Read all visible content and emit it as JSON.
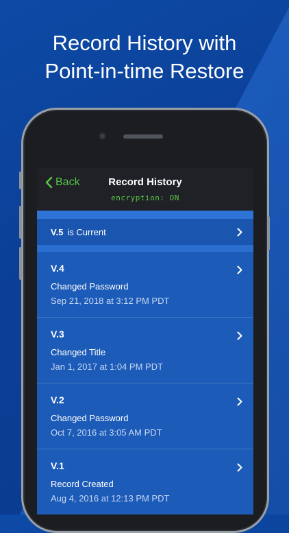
{
  "headline": {
    "line1": "Record History with",
    "line2": "Point-in-time Restore"
  },
  "navbar": {
    "back_label": "Back",
    "title": "Record History",
    "encryption": "encryption: ON"
  },
  "current": {
    "version": "V.5",
    "status": "is Current"
  },
  "history": [
    {
      "version": "V.4",
      "action": "Changed Password",
      "date": "Sep 21, 2018 at 3:12 PM PDT"
    },
    {
      "version": "V.3",
      "action": "Changed Title",
      "date": "Jan 1, 2017 at 1:04 PM PDT"
    },
    {
      "version": "V.2",
      "action": "Changed Password",
      "date": "Oct 7, 2016 at 3:05 AM PDT"
    },
    {
      "version": "V.1",
      "action": "Record Created",
      "date": "Aug 4, 2016 at 12:13 PM PDT"
    }
  ],
  "colors": {
    "accent_green": "#57c545",
    "navbar_bg": "#1f2126",
    "list_bg": "#1c5bb8"
  }
}
